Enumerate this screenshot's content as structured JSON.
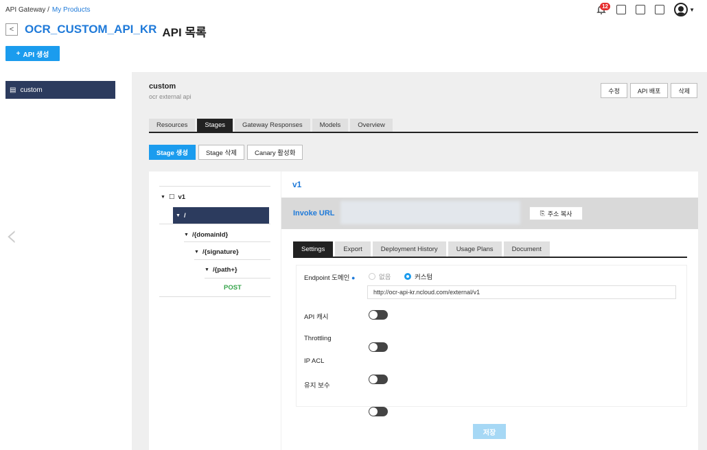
{
  "breadcrumb": {
    "root": "API Gateway /",
    "current": "My Products"
  },
  "header": {
    "product": "OCR_CUSTOM_API_KR",
    "title": "API 목록",
    "back_glyph": "<"
  },
  "create_api": {
    "label": "API 생성",
    "icon": "plus-icon"
  },
  "notifications": {
    "count": "12"
  },
  "sidebar": {
    "items": [
      {
        "label": "custom",
        "icon": "list-icon"
      }
    ]
  },
  "api": {
    "name": "custom",
    "description": "ocr external api"
  },
  "actions": {
    "edit": "수정",
    "deploy": "API 배포",
    "delete": "삭제"
  },
  "tabs": [
    {
      "label": "Resources"
    },
    {
      "label": "Stages"
    },
    {
      "label": "Gateway Responses"
    },
    {
      "label": "Models"
    },
    {
      "label": "Overview"
    }
  ],
  "stage_buttons": {
    "create": "Stage 생성",
    "delete": "Stage 삭제",
    "canary": "Canary 활성화"
  },
  "tree": {
    "stage": "v1",
    "nodes": [
      {
        "label": "/"
      },
      {
        "label": "/{domainId}"
      },
      {
        "label": "/{signature}"
      },
      {
        "label": "/{path+}"
      }
    ],
    "method": "POST"
  },
  "detail": {
    "stage_title": "v1",
    "invoke_label": "Invoke URL",
    "copy_label": "주소 복사",
    "tabs": [
      {
        "label": "Settings"
      },
      {
        "label": "Export"
      },
      {
        "label": "Deployment History"
      },
      {
        "label": "Usage Plans"
      },
      {
        "label": "Document"
      }
    ],
    "endpoint_label": "Endpoint 도메인",
    "radio_none": "없음",
    "radio_custom": "커스텀",
    "endpoint_url": "http://ocr-api-kr.ncloud.com/external/v1",
    "api_cache": "API 캐시",
    "throttling": "Throttling",
    "ip_acl": "IP ACL",
    "maintenance": "유지 보수",
    "save": "저장"
  }
}
